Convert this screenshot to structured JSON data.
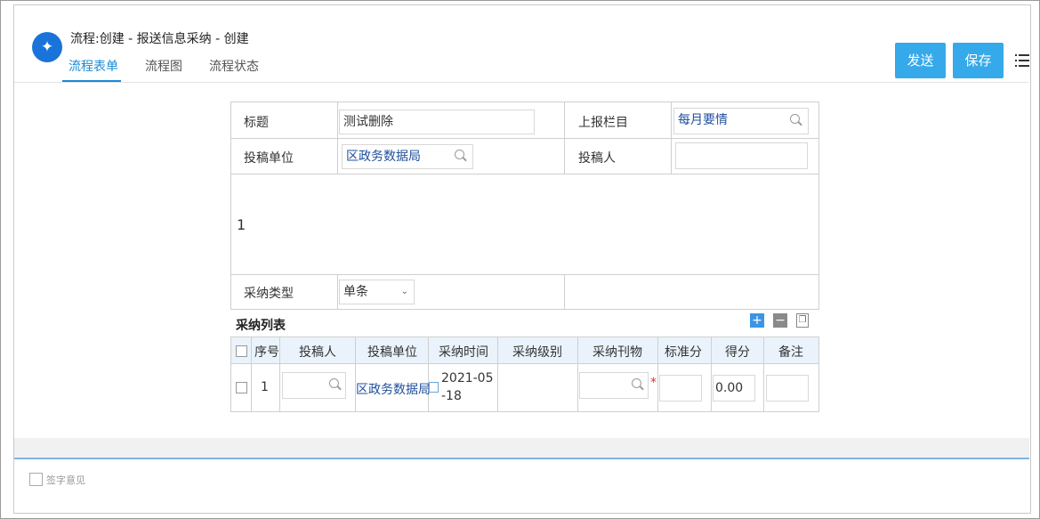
{
  "app": {
    "logo_glyph": "✦",
    "title": "流程:创建 - 报送信息采纳 - 创建",
    "tabs": [
      {
        "label": "流程表单",
        "active": true
      },
      {
        "label": "流程图",
        "active": false
      },
      {
        "label": "流程状态",
        "active": false
      }
    ],
    "buttons": {
      "send": "发送",
      "save": "保存"
    }
  },
  "form": {
    "title_label": "标题",
    "title_value": "测试删除",
    "column_label": "上报栏目",
    "column_value": "每月要情",
    "unit_label": "投稿单位",
    "unit_value": "区政务数据局",
    "submitter_label": "投稿人",
    "submitter_value": "",
    "content": "1",
    "adopt_type_label": "采纳类型",
    "adopt_type_value": "单条"
  },
  "adopt_list": {
    "title": "采纳列表",
    "columns": [
      "序号",
      "投稿人",
      "投稿单位",
      "采纳时间",
      "采纳级别",
      "采纳刊物",
      "标准分",
      "得分",
      "备注"
    ],
    "rows": [
      {
        "index": "1",
        "submitter": "",
        "unit": "区政务数据局",
        "time": "2021-05-18",
        "level": "",
        "publication": "",
        "standard_score": "",
        "score": "0.00",
        "remark": ""
      }
    ]
  },
  "footer": {
    "sign_label": "签字意见"
  },
  "colors": {
    "accent": "#35a9ea",
    "tab_active": "#1a8ad6",
    "link": "#1f4f9c",
    "required": "#e03030"
  }
}
